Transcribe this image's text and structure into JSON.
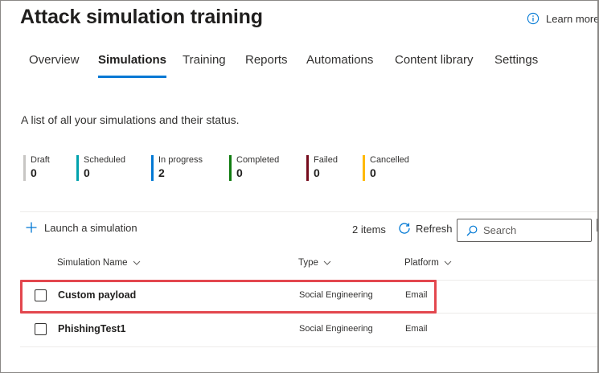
{
  "page": {
    "title": "Attack simulation training"
  },
  "learn_more": {
    "label": "Learn more",
    "icon": "info-icon"
  },
  "tabs": [
    {
      "label": "Overview",
      "active": false
    },
    {
      "label": "Simulations",
      "active": true
    },
    {
      "label": "Training",
      "active": false
    },
    {
      "label": "Reports",
      "active": false
    },
    {
      "label": "Automations",
      "active": false
    },
    {
      "label": "Content library",
      "active": false
    },
    {
      "label": "Settings",
      "active": false
    }
  ],
  "description": "A list of all your simulations and their status.",
  "statuses": [
    {
      "label": "Draft",
      "count": "0",
      "color": "#c8c6c4"
    },
    {
      "label": "Scheduled",
      "count": "0",
      "color": "#00a2ad"
    },
    {
      "label": "In progress",
      "count": "2",
      "color": "#0078d4"
    },
    {
      "label": "Completed",
      "count": "0",
      "color": "#107c10"
    },
    {
      "label": "Failed",
      "count": "0",
      "color": "#750b1c"
    },
    {
      "label": "Cancelled",
      "count": "0",
      "color": "#ffb900"
    }
  ],
  "toolbar": {
    "launch_label": "Launch a simulation",
    "items_count": "2 items",
    "refresh_label": "Refresh",
    "search_placeholder": "Search"
  },
  "columns": {
    "name": "Simulation Name",
    "type": "Type",
    "platform": "Platform"
  },
  "rows": [
    {
      "name": "Custom payload",
      "type": "Social Engineering",
      "platform": "Email",
      "highlighted": true
    },
    {
      "name": "PhishingTest1",
      "type": "Social Engineering",
      "platform": "Email",
      "highlighted": false
    }
  ],
  "colors": {
    "accent": "#0078d4",
    "highlight": "#e3474e"
  }
}
